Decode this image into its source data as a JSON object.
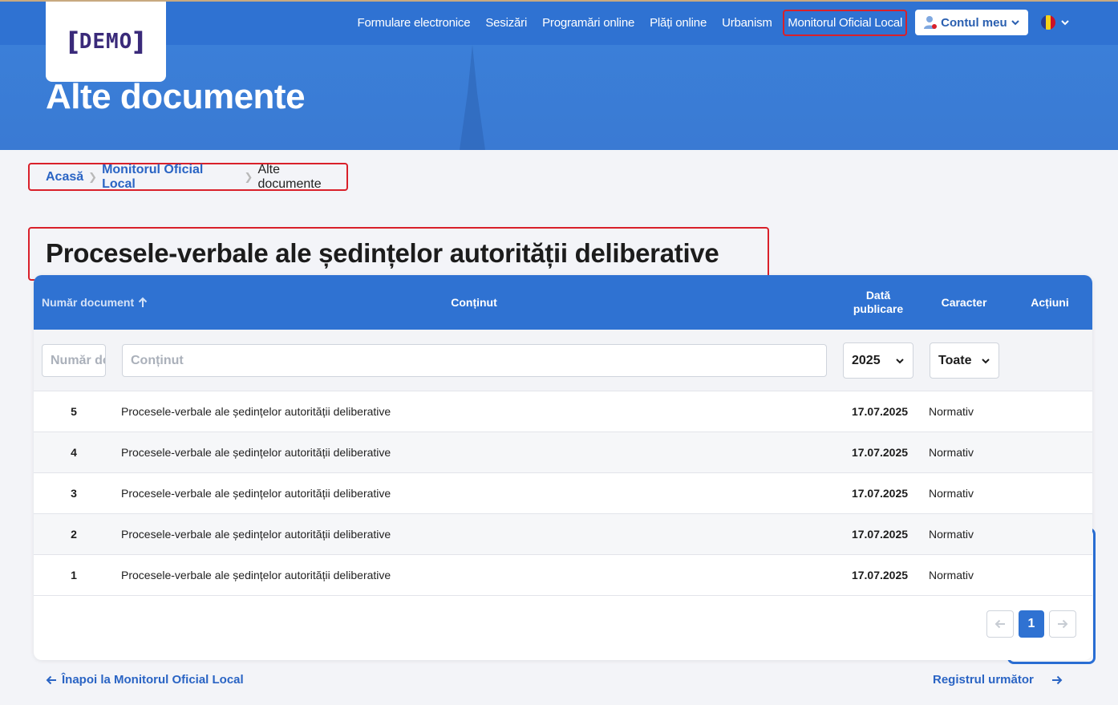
{
  "logo": {
    "text": "DEMO"
  },
  "nav": {
    "items": [
      "Formulare electronice",
      "Sesizări",
      "Programări online",
      "Plăți online",
      "Urbanism",
      "Monitorul Oficial Local"
    ],
    "account_label": "Contul meu"
  },
  "hero": {
    "title": "Alte documente"
  },
  "breadcrumb": {
    "home": "Acasă",
    "parent": "Monitorul Oficial Local",
    "current": "Alte documente"
  },
  "section": {
    "title": "Procesele-verbale ale ședințelor autorității deliberative"
  },
  "table": {
    "headers": {
      "number": "Număr document",
      "content": "Conținut",
      "date_line1": "Dată",
      "date_line2": "publicare",
      "character": "Caracter",
      "actions": "Acțiuni"
    },
    "filters": {
      "number_placeholder": "Număr document",
      "content_placeholder": "Conținut",
      "year": "2025",
      "character": "Toate"
    },
    "rows": [
      {
        "number": "5",
        "content": "Procesele-verbale ale ședințelor autorității deliberative",
        "date": "17.07.2025",
        "character": "Normativ"
      },
      {
        "number": "4",
        "content": "Procesele-verbale ale ședințelor autorității deliberative",
        "date": "17.07.2025",
        "character": "Normativ"
      },
      {
        "number": "3",
        "content": "Procesele-verbale ale ședințelor autorității deliberative",
        "date": "17.07.2025",
        "character": "Normativ"
      },
      {
        "number": "2",
        "content": "Procesele-verbale ale ședințelor autorității deliberative",
        "date": "17.07.2025",
        "character": "Normativ"
      },
      {
        "number": "1",
        "content": "Procesele-verbale ale ședințelor autorității deliberative",
        "date": "17.07.2025",
        "character": "Normativ"
      }
    ],
    "pagination": {
      "current_page": "1"
    }
  },
  "footer_links": {
    "back": "Înapoi la Monitorul Oficial Local",
    "next": "Registrul următor"
  },
  "colors": {
    "primary": "#2f72d2",
    "highlight": "#d9202a",
    "link": "#2a64c4"
  },
  "icons": [
    "user-icon",
    "romania-flag-icon",
    "chevron-down-icon",
    "sort-up-icon",
    "arrow-left-icon",
    "arrow-right-icon"
  ]
}
